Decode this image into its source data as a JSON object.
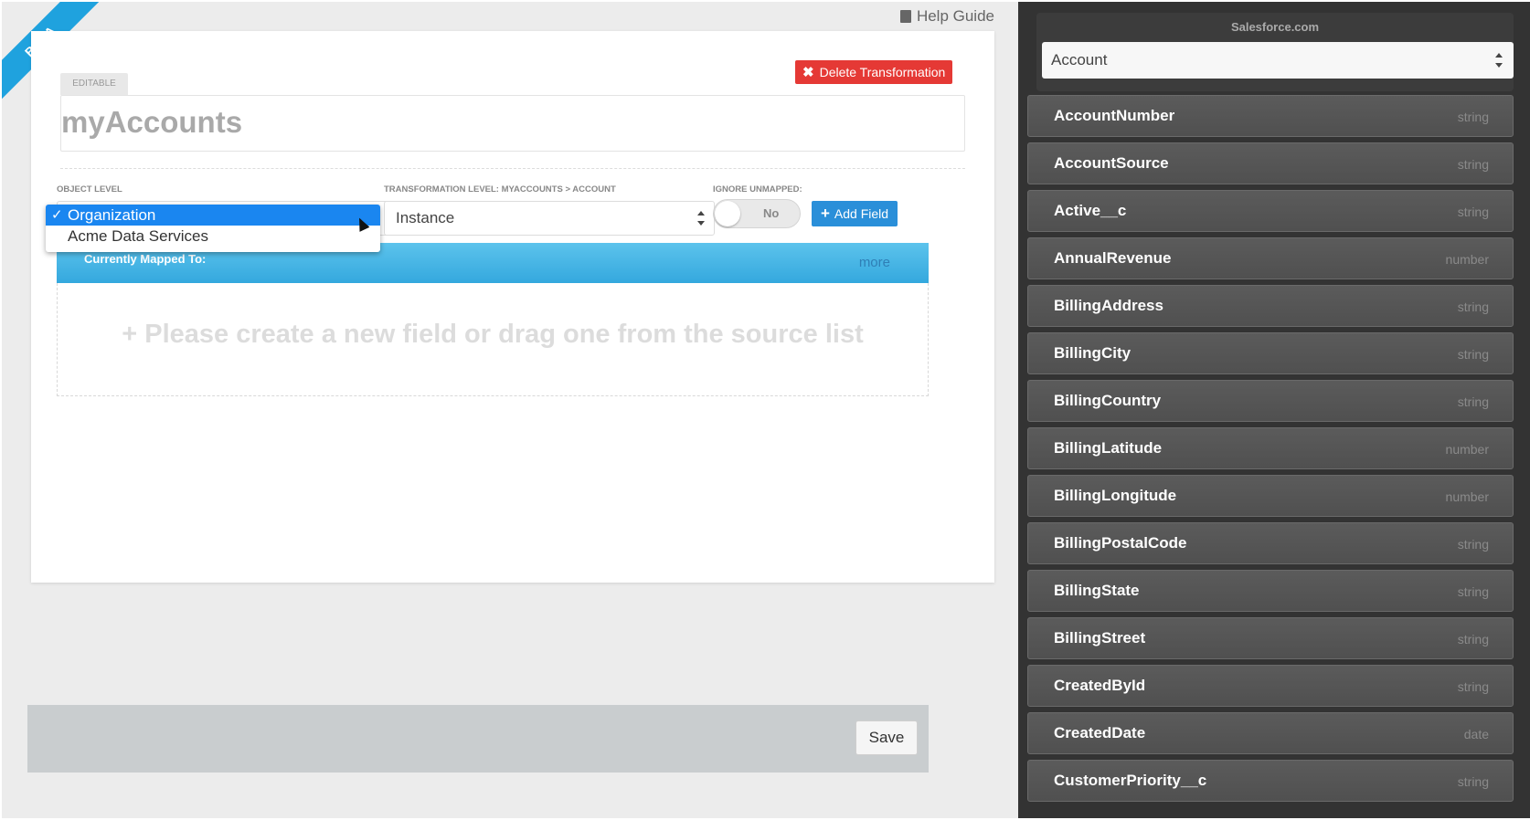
{
  "app": {
    "beta_label": "BETA",
    "help_label": "Help Guide"
  },
  "editor": {
    "delete_label": "Delete Transformation",
    "editable_tag": "EDITABLE",
    "title": "myAccounts",
    "object_level_label": "OBJECT LEVEL",
    "object_options": [
      "Organization",
      "Acme Data Services"
    ],
    "object_selected": "Organization",
    "transformation_level_label": "TRANSFORMATION LEVEL: MYACCOUNTS > ACCOUNT",
    "instance_value": "Instance",
    "ignore_unmapped_label": "IGNORE UNMAPPED:",
    "ignore_unmapped_value": "No",
    "add_field_label": "Add Field",
    "mapped_label": "Currently Mapped To:",
    "more_label": "more",
    "empty_hint": "Please create a new field or drag one from the source list",
    "save_label": "Save"
  },
  "source": {
    "name": "Salesforce.com",
    "object": "Account",
    "fields": [
      {
        "name": "AccountNumber",
        "type": "string"
      },
      {
        "name": "AccountSource",
        "type": "string"
      },
      {
        "name": "Active__c",
        "type": "string"
      },
      {
        "name": "AnnualRevenue",
        "type": "number"
      },
      {
        "name": "BillingAddress",
        "type": "string"
      },
      {
        "name": "BillingCity",
        "type": "string"
      },
      {
        "name": "BillingCountry",
        "type": "string"
      },
      {
        "name": "BillingLatitude",
        "type": "number"
      },
      {
        "name": "BillingLongitude",
        "type": "number"
      },
      {
        "name": "BillingPostalCode",
        "type": "string"
      },
      {
        "name": "BillingState",
        "type": "string"
      },
      {
        "name": "BillingStreet",
        "type": "string"
      },
      {
        "name": "CreatedById",
        "type": "string"
      },
      {
        "name": "CreatedDate",
        "type": "date"
      },
      {
        "name": "CustomerPriority__c",
        "type": "string"
      }
    ]
  },
  "colors": {
    "accent": "#2a8fd9",
    "danger": "#e53935",
    "panel": "#333333"
  }
}
